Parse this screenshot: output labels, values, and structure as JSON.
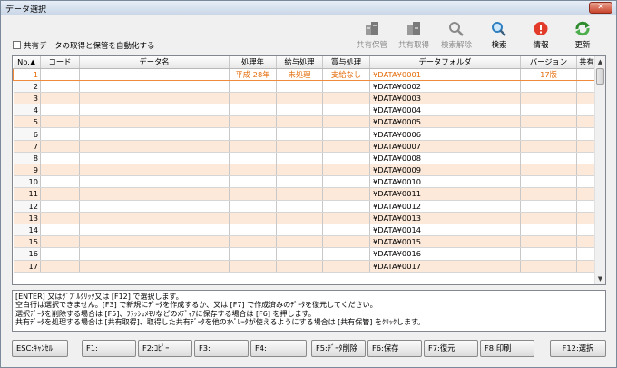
{
  "window": {
    "title": "データ選択",
    "close_label": "✕"
  },
  "toolbar": {
    "share_save": {
      "label": "共有保管",
      "icon": "share-save-icon",
      "enabled": false
    },
    "share_get": {
      "label": "共有取得",
      "icon": "share-get-icon",
      "enabled": false
    },
    "search_clear": {
      "label": "検索解除",
      "icon": "search-clear-icon",
      "enabled": false
    },
    "search": {
      "label": "検索",
      "icon": "search-icon",
      "enabled": true
    },
    "info": {
      "label": "情報",
      "icon": "info-icon",
      "enabled": true
    },
    "refresh": {
      "label": "更新",
      "icon": "refresh-icon",
      "enabled": true
    }
  },
  "auto_share": {
    "label": "共有データの取得と保管を自動化する",
    "checked": false
  },
  "table": {
    "columns": [
      "No.▲",
      "コード",
      "データ名",
      "処理年",
      "給与処理",
      "賞与処理",
      "データフォルダ",
      "バージョン",
      "共有"
    ],
    "rows": [
      {
        "no": "1",
        "code": "",
        "name": "",
        "year": "平成 28年",
        "salary": "未処理",
        "bonus": "支給なし",
        "folder": "¥DATA¥0001",
        "version": "17版",
        "shared": ""
      },
      {
        "no": "2",
        "code": "",
        "name": "",
        "year": "",
        "salary": "",
        "bonus": "",
        "folder": "¥DATA¥0002",
        "version": "",
        "shared": ""
      },
      {
        "no": "3",
        "code": "",
        "name": "",
        "year": "",
        "salary": "",
        "bonus": "",
        "folder": "¥DATA¥0003",
        "version": "",
        "shared": ""
      },
      {
        "no": "4",
        "code": "",
        "name": "",
        "year": "",
        "salary": "",
        "bonus": "",
        "folder": "¥DATA¥0004",
        "version": "",
        "shared": ""
      },
      {
        "no": "5",
        "code": "",
        "name": "",
        "year": "",
        "salary": "",
        "bonus": "",
        "folder": "¥DATA¥0005",
        "version": "",
        "shared": ""
      },
      {
        "no": "6",
        "code": "",
        "name": "",
        "year": "",
        "salary": "",
        "bonus": "",
        "folder": "¥DATA¥0006",
        "version": "",
        "shared": ""
      },
      {
        "no": "7",
        "code": "",
        "name": "",
        "year": "",
        "salary": "",
        "bonus": "",
        "folder": "¥DATA¥0007",
        "version": "",
        "shared": ""
      },
      {
        "no": "8",
        "code": "",
        "name": "",
        "year": "",
        "salary": "",
        "bonus": "",
        "folder": "¥DATA¥0008",
        "version": "",
        "shared": ""
      },
      {
        "no": "9",
        "code": "",
        "name": "",
        "year": "",
        "salary": "",
        "bonus": "",
        "folder": "¥DATA¥0009",
        "version": "",
        "shared": ""
      },
      {
        "no": "10",
        "code": "",
        "name": "",
        "year": "",
        "salary": "",
        "bonus": "",
        "folder": "¥DATA¥0010",
        "version": "",
        "shared": ""
      },
      {
        "no": "11",
        "code": "",
        "name": "",
        "year": "",
        "salary": "",
        "bonus": "",
        "folder": "¥DATA¥0011",
        "version": "",
        "shared": ""
      },
      {
        "no": "12",
        "code": "",
        "name": "",
        "year": "",
        "salary": "",
        "bonus": "",
        "folder": "¥DATA¥0012",
        "version": "",
        "shared": ""
      },
      {
        "no": "13",
        "code": "",
        "name": "",
        "year": "",
        "salary": "",
        "bonus": "",
        "folder": "¥DATA¥0013",
        "version": "",
        "shared": ""
      },
      {
        "no": "14",
        "code": "",
        "name": "",
        "year": "",
        "salary": "",
        "bonus": "",
        "folder": "¥DATA¥0014",
        "version": "",
        "shared": ""
      },
      {
        "no": "15",
        "code": "",
        "name": "",
        "year": "",
        "salary": "",
        "bonus": "",
        "folder": "¥DATA¥0015",
        "version": "",
        "shared": ""
      },
      {
        "no": "16",
        "code": "",
        "name": "",
        "year": "",
        "salary": "",
        "bonus": "",
        "folder": "¥DATA¥0016",
        "version": "",
        "shared": ""
      },
      {
        "no": "17",
        "code": "",
        "name": "",
        "year": "",
        "salary": "",
        "bonus": "",
        "folder": "¥DATA¥0017",
        "version": "",
        "shared": ""
      }
    ]
  },
  "help_lines": [
    "[ENTER] 又はﾀﾞﾌﾞﾙｸﾘｯｸ又は [F12] で選択します。",
    "空白行は選択できません。[F3] で新規にﾃﾞｰﾀを作成するか、又は [F7] で作成済みのﾃﾞｰﾀを復元してください。",
    "選択ﾃﾞｰﾀを削除する場合は [F5]、ﾌﾗｯｼｭﾒﾓﾘなどのﾒﾃﾞｨｱに保存する場合は [F6] を押します。",
    "共有ﾃﾞｰﾀを処理する場合は [共有取得]、取得した共有ﾃﾞｰﾀを他のｵﾍﾟﾚｰﾀが使えるようにする場合は [共有保管] をｸﾘｯｸします。"
  ],
  "fkeys": {
    "esc": "ESC:ｷｬﾝｾﾙ",
    "f1": "F1:",
    "f2": "F2:ｺﾋﾟｰ",
    "f3": "F3:",
    "f4": "F4:",
    "f5": "F5:ﾃﾞｰﾀ削除",
    "f6": "F6:保存",
    "f7": "F7:復元",
    "f8": "F8:印刷",
    "f12": "F12:選択"
  },
  "colors": {
    "selected_text": "#e46c0a",
    "alt_row": "#fde9d9",
    "selected_border": "#f08a3c"
  }
}
